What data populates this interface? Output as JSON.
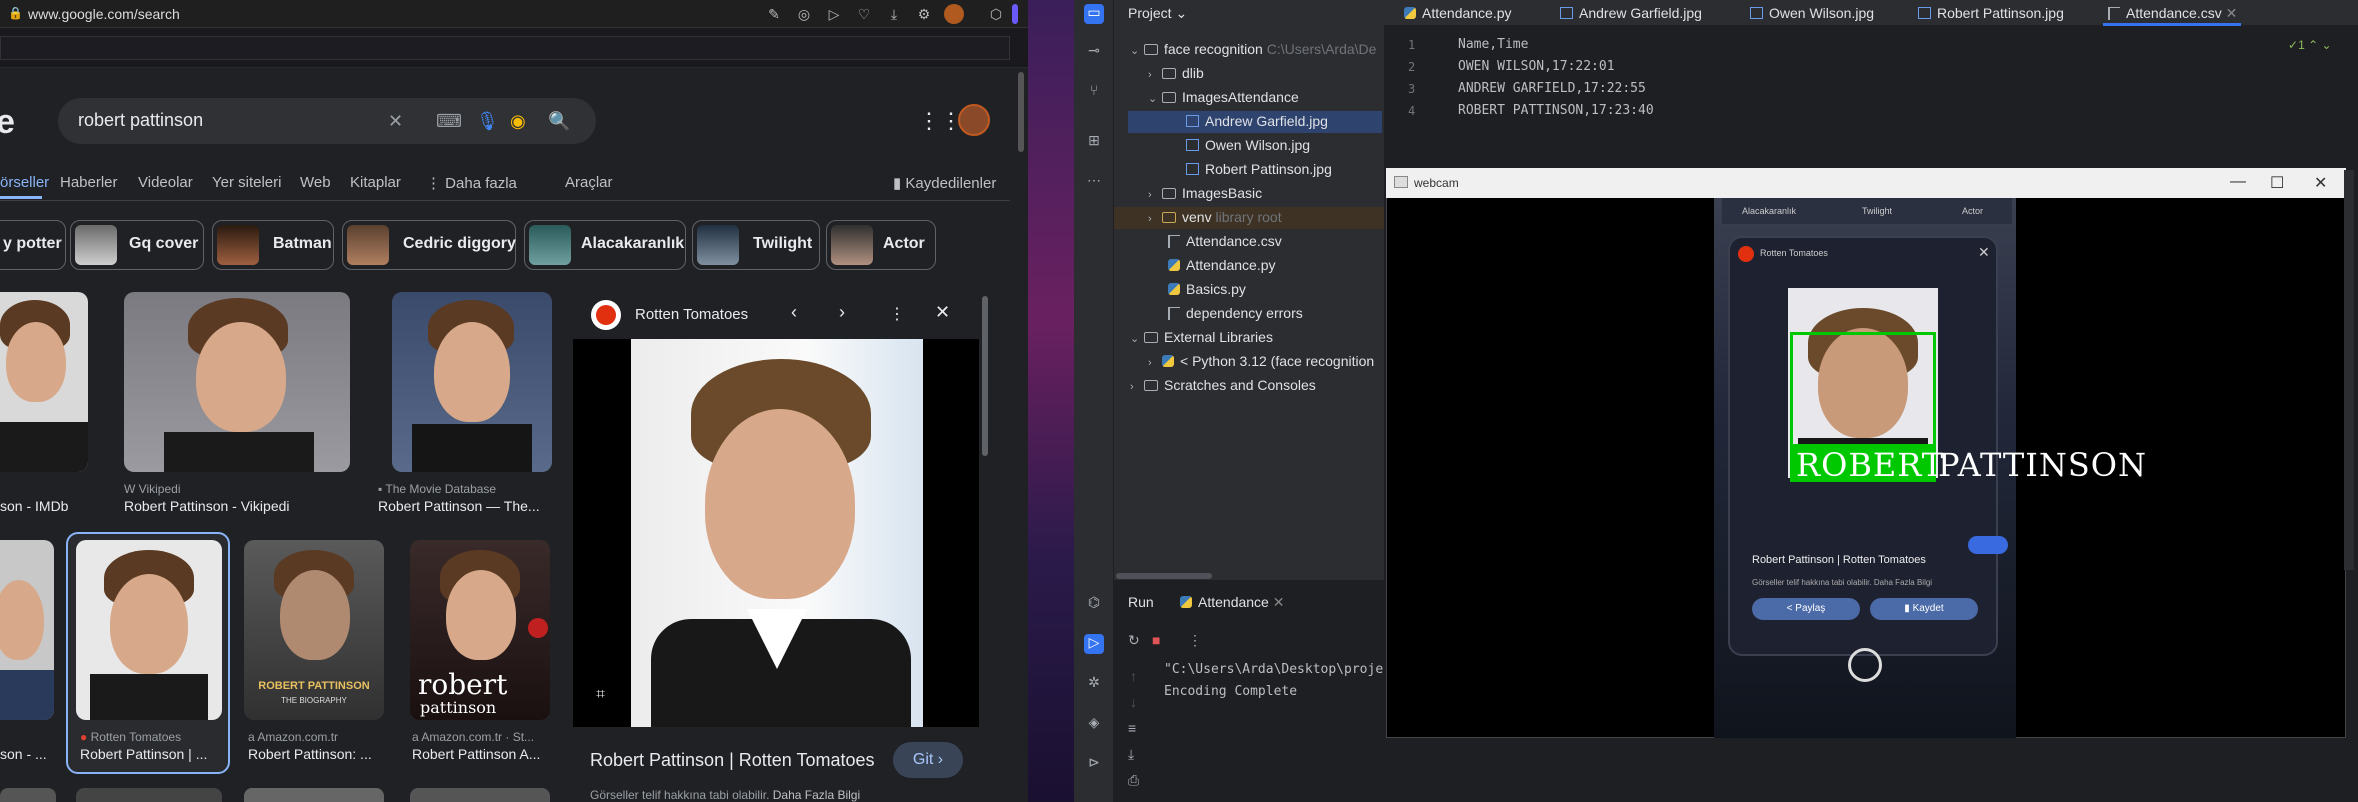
{
  "browser": {
    "url": "www.google.com/search",
    "search_query": "robert pattinson",
    "logo_fragment": "e",
    "nav_tabs": [
      "örseller",
      "Haberler",
      "Videolar",
      "Yer siteleri",
      "Web",
      "Kitaplar",
      "Daha fazla",
      "Araçlar"
    ],
    "saved_label": "Kaydedilenler",
    "chips": [
      "y potter",
      "Gq cover",
      "Batman",
      "Cedric diggory",
      "Alacakaranlık",
      "Twilight",
      "Actor"
    ],
    "results": [
      {
        "source": "",
        "title": "son - IMDb"
      },
      {
        "source": "Vikipedi",
        "title": "Robert Pattinson - Vikipedi"
      },
      {
        "source": "The Movie Database",
        "title": "Robert Pattinson — The..."
      },
      {
        "source": "",
        "title": "son - ..."
      },
      {
        "source": "Rotten Tomatoes",
        "title": "Robert Pattinson | ..."
      },
      {
        "source": "Amazon.com.tr",
        "title": "Robert Pattinson: ..."
      },
      {
        "source": "Amazon.com.tr · St...",
        "title": "Robert Pattinson A..."
      }
    ],
    "book1_text": "ROBERT PATTINSON",
    "book1_sub": "THE BIOGRAPHY",
    "book2_text": "robert",
    "book2_sub": "pattinson",
    "side_panel": {
      "source": "Rotten Tomatoes",
      "title": "Robert Pattinson | Rotten Tomatoes",
      "go_button": "Git",
      "subtitle": "Görseller telif hakkına tabi olabilir.",
      "more_info": "Daha Fazla Bilgi"
    }
  },
  "ide": {
    "project_label": "Project",
    "tree": [
      {
        "name": "face recognition",
        "extra": "C:\\Users\\Arda\\De"
      },
      {
        "name": "dlib",
        "extra": ""
      },
      {
        "name": "ImagesAttendance",
        "extra": ""
      },
      {
        "name": "Andrew Garfield.jpg",
        "extra": ""
      },
      {
        "name": "Owen Wilson.jpg",
        "extra": ""
      },
      {
        "name": "Robert Pattinson.jpg",
        "extra": ""
      },
      {
        "name": "ImagesBasic",
        "extra": ""
      },
      {
        "name": "venv",
        "extra": "library root"
      },
      {
        "name": "Attendance.csv",
        "extra": ""
      },
      {
        "name": "Attendance.py",
        "extra": ""
      },
      {
        "name": "Basics.py",
        "extra": ""
      },
      {
        "name": "dependency errors",
        "extra": ""
      },
      {
        "name": "External Libraries",
        "extra": ""
      },
      {
        "name": "< Python 3.12 (face recognition",
        "extra": ""
      },
      {
        "name": "Scratches and Consoles",
        "extra": ""
      }
    ],
    "editor_tabs": [
      "Attendance.py",
      "Andrew Garfield.jpg",
      "Owen Wilson.jpg",
      "Robert Pattinson.jpg",
      "Attendance.csv"
    ],
    "code_lines": [
      "Name,Time",
      "OWEN WILSON,17:22:01",
      "ANDREW GARFIELD,17:22:55",
      "ROBERT PATTINSON,17:23:40"
    ],
    "line_numbers": [
      "1",
      "2",
      "3",
      "4"
    ],
    "inspection_count": "1",
    "run_label": "Run",
    "run_tab": "Attendance",
    "console_lines": [
      "\"C:\\Users\\Arda\\Desktop\\proje",
      "Encoding Complete"
    ]
  },
  "webcam": {
    "title": "webcam",
    "label_part1": "ROBERT",
    "label_part2": "PATTINSON",
    "phone_chips": [
      "Alacakaranlık",
      "Twilight",
      "Actor"
    ],
    "phone_source": "Rotten Tomatoes",
    "phone_title": "Robert Pattinson | Rotten Tomatoes",
    "phone_sub": "Görseller telif hakkına tabi olabilir. Daha Fazla Bilgi",
    "phone_share": "Paylaş",
    "phone_save": "Kaydet"
  }
}
